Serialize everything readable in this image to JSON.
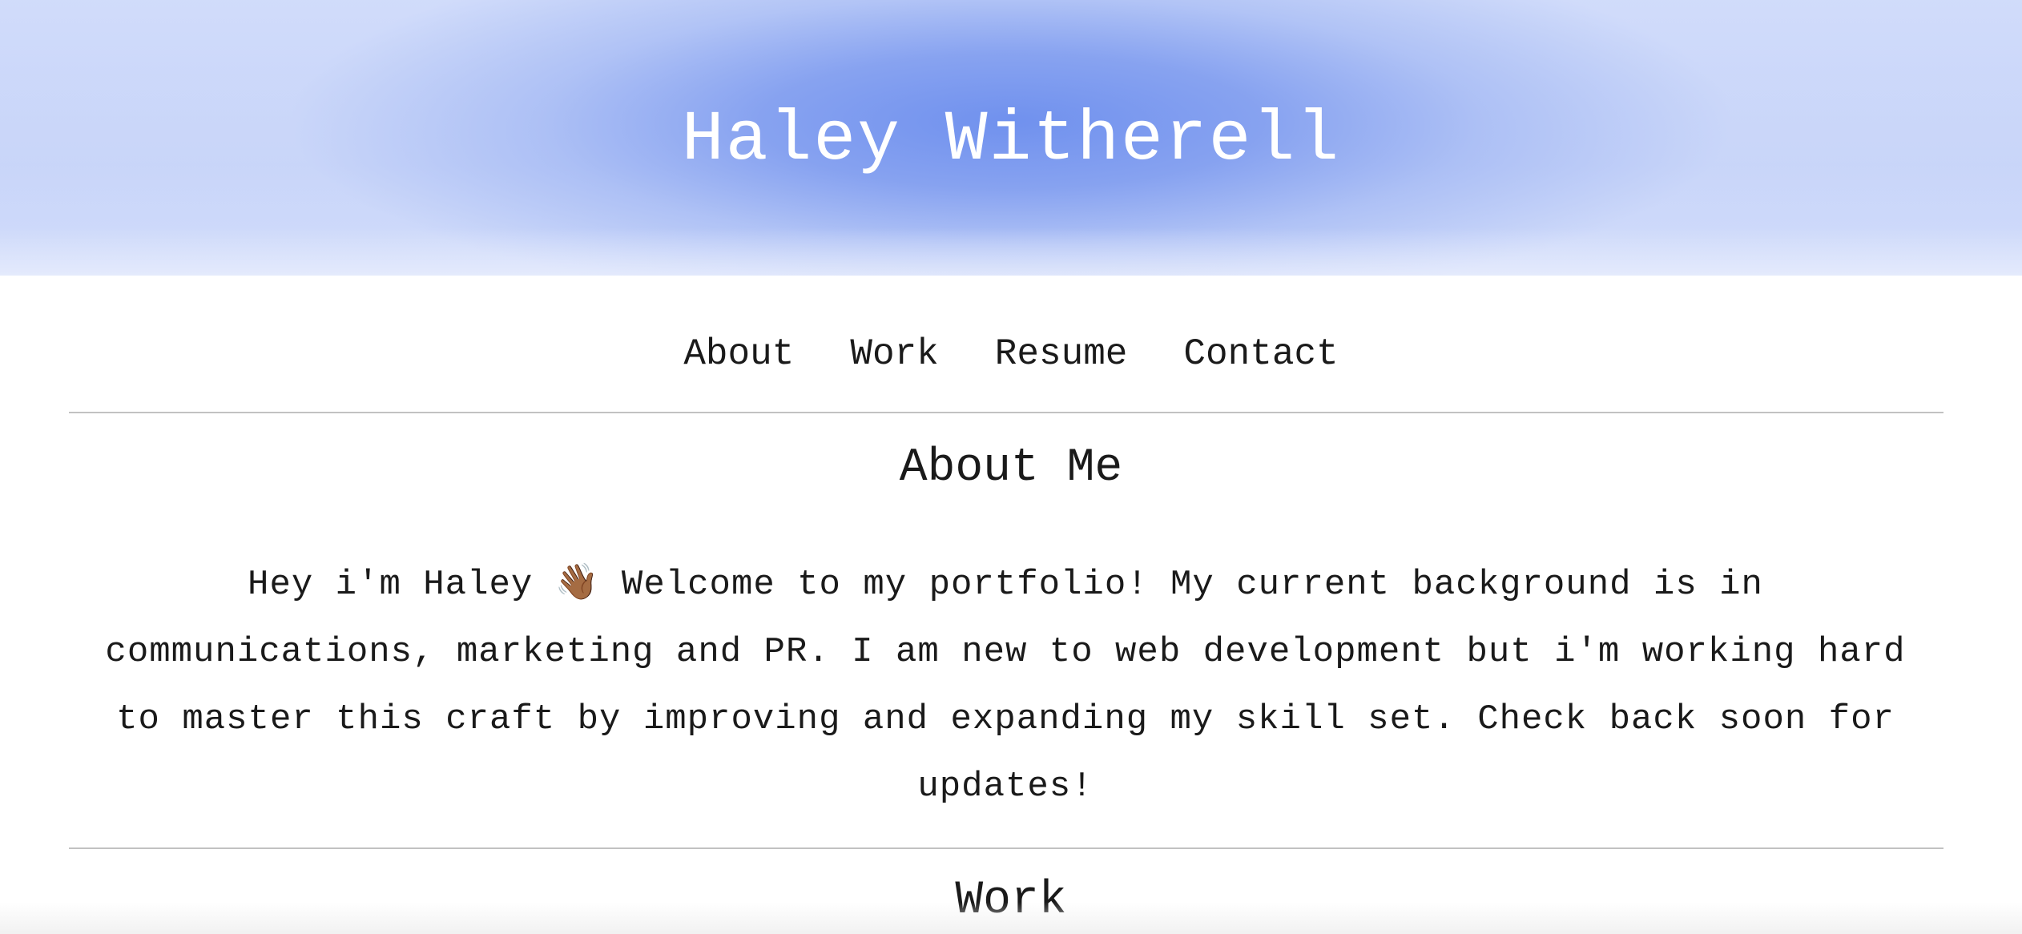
{
  "header": {
    "title": "Haley Witherell"
  },
  "nav": {
    "items": [
      {
        "label": "About"
      },
      {
        "label": "Work"
      },
      {
        "label": "Resume"
      },
      {
        "label": "Contact"
      }
    ]
  },
  "about": {
    "heading": "About Me",
    "text_before_icon": "Hey i'm Haley",
    "wave_icon": "👋🏾",
    "text_after_icon": "Welcome to my portfolio! My current background is in communications, marketing and PR. I am new to web development but i'm working hard to master this craft by improving and expanding my skill set. Check back soon for updates!"
  },
  "work": {
    "heading": "Work"
  },
  "colors": {
    "hero_blue": "#7091ee",
    "divider": "#c2c2c2",
    "text": "#1a1a1a"
  }
}
